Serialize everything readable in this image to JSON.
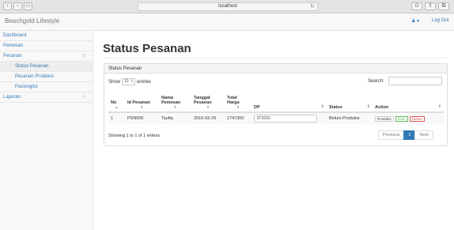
{
  "browser": {
    "url": "localhost",
    "back_glyph": "‹",
    "forward_glyph": "›",
    "sidebar_glyph": "▭",
    "reload_glyph": "↻",
    "right_glyphs": [
      "⊙",
      "⇪",
      "⧉"
    ]
  },
  "topbar": {
    "brand": "Beachgold Lifestyle",
    "user_glyph": "♟ ▾",
    "logout": "Log Out"
  },
  "sidebar": {
    "items": [
      {
        "label": "Dashboard",
        "sub": false,
        "active": false,
        "arrow": ""
      },
      {
        "label": "Pemesan",
        "sub": false,
        "active": false,
        "arrow": ""
      },
      {
        "label": "Pesanan",
        "sub": false,
        "active": false,
        "arrow": "v"
      },
      {
        "label": "Status Pesanan",
        "sub": true,
        "active": true,
        "arrow": ""
      },
      {
        "label": "Pesanan Produksi",
        "sub": true,
        "active": false,
        "arrow": ""
      },
      {
        "label": "Packinglist",
        "sub": true,
        "active": false,
        "arrow": ""
      },
      {
        "label": "Laporan",
        "sub": false,
        "active": false,
        "arrow": "<"
      }
    ]
  },
  "main": {
    "title": "Status Pesanan",
    "panel_heading": "Status Pesanan",
    "show_label": "Show",
    "entries_value": "10",
    "entries_label": "entries",
    "search_label": "Search:",
    "search_value": "",
    "columns": [
      "No",
      "Id Pesanan",
      "Nama Pemesan",
      "Tanggal Pesanan",
      "Total Harga",
      "DP",
      "Status",
      "Action"
    ],
    "rows": [
      {
        "no": "1",
        "id": "PSN006",
        "nama": "Taufiq",
        "tanggal": "2016-03-29",
        "total": "1747300",
        "dp": "873650",
        "status": "Belum Produksi",
        "actions": [
          "Produksi",
          "Kirim",
          "Delete"
        ]
      }
    ],
    "info": "Showing 1 to 1 of 1 entries",
    "pagination": {
      "previous": "Previous",
      "current": "1",
      "next": "Next"
    }
  },
  "colors": {
    "link": "#337ab7",
    "green": "#5cb85c",
    "red": "#d9534f"
  }
}
